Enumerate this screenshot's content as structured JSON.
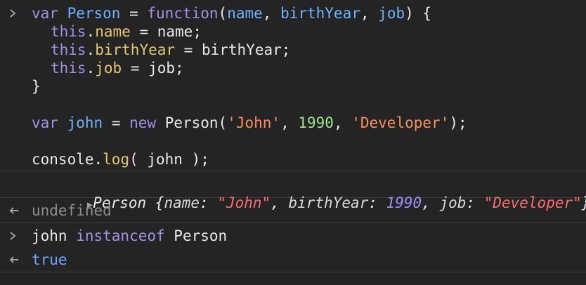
{
  "input_code": {
    "l1": {
      "k1": "var",
      "t1": " ",
      "i1": "Person",
      "t2": " = ",
      "k2": "function",
      "t3": "(",
      "i2": "name",
      "t4": ", ",
      "i3": "birthYear",
      "t5": ", ",
      "i4": "job",
      "t6": ") {"
    },
    "l2": {
      "k1": "this",
      "t1": ".",
      "p1": "name",
      "t2": " = name;"
    },
    "l3": {
      "k1": "this",
      "t1": ".",
      "p1": "birthYear",
      "t2": " = birthYear;"
    },
    "l4": {
      "k1": "this",
      "t1": ".",
      "p1": "job",
      "t2": " = job;"
    },
    "l5": {
      "t1": "}"
    },
    "l7": {
      "k1": "var",
      "t1": " ",
      "i1": "john",
      "t2": " = ",
      "k2": "new",
      "t3": " Person(",
      "s1": "'John'",
      "t4": ", ",
      "n1": "1990",
      "t5": ", ",
      "s2": "'Developer'",
      "t6": ");"
    },
    "l9": {
      "t1": "console.",
      "p1": "log",
      "t2": "( john );"
    }
  },
  "output_object": {
    "class_name": "Person",
    "brace_open": " {",
    "key_name": "name",
    "val_name": "\"John\"",
    "key_birth": "birthYear",
    "val_birth": "1990",
    "key_job": "job",
    "val_job": "\"Developer\"",
    "colon": ": ",
    "comma": ", ",
    "brace_close": "}",
    "expand_icon": "triangle-right"
  },
  "return_1": {
    "text": "undefined"
  },
  "input_2": {
    "t1": "john ",
    "k1": "instanceof",
    "t2": " Person"
  },
  "return_2": {
    "text": "true"
  },
  "icons": {
    "prompt": "chevron-right",
    "result": "arrow-return"
  },
  "colors": {
    "background": "#242424",
    "keyword": "#a58fe6",
    "identifier": "#6fb3ff",
    "property": "#e3c96e",
    "string": "#ff8e5e",
    "number": "#9de88c"
  }
}
